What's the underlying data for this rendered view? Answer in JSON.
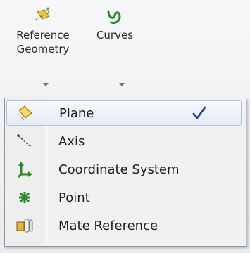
{
  "ribbon": {
    "reference_geometry": {
      "label_line1": "Reference",
      "label_line2": "Geometry",
      "icon": "reference-geometry-icon"
    },
    "curves": {
      "label": "Curves",
      "icon": "curves-icon"
    }
  },
  "menu": {
    "items": [
      {
        "label": "Plane",
        "icon": "plane-icon",
        "checked": true,
        "highlighted": true
      },
      {
        "label": "Axis",
        "icon": "axis-icon",
        "checked": false,
        "highlighted": false
      },
      {
        "label": "Coordinate System",
        "icon": "coordinate-system-icon",
        "checked": false,
        "highlighted": false
      },
      {
        "label": "Point",
        "icon": "point-icon",
        "checked": false,
        "highlighted": false
      },
      {
        "label": "Mate Reference",
        "icon": "mate-reference-icon",
        "checked": false,
        "highlighted": false
      }
    ]
  },
  "colors": {
    "check": "#1f3c9e",
    "plane_icon": "#e8b71a",
    "green_icons": "#2a8a2a"
  }
}
